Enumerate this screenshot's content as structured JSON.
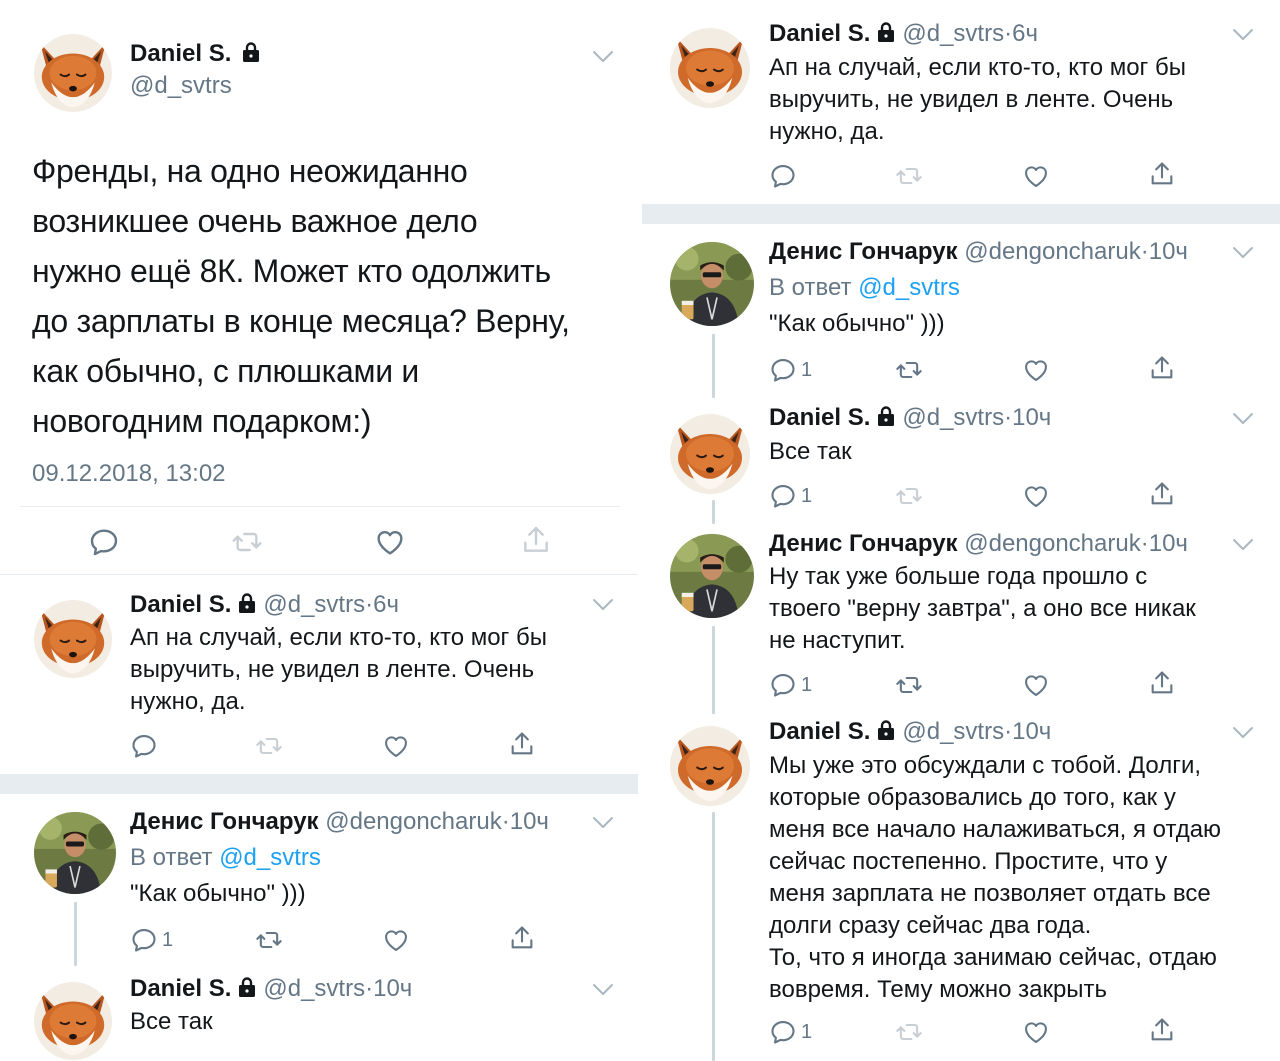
{
  "main_tweet": {
    "name": "Daniel S.",
    "handle": "@d_svtrs",
    "text": "Френды, на одно неожиданно\nвозникшее очень важное дело\nнужно ещё 8К. Может кто одолжить\nдо зарплаты в конце месяца? Верну,\nкак обычно, с плюшками и\nновогодним подарком:)",
    "timestamp": "09.12.2018, 13:02"
  },
  "left_tweets": [
    {
      "name": "Daniel S.",
      "handle": "@d_svtrs",
      "dot": "·",
      "time": "6ч",
      "text": "Ап на случай, если кто-то, кто мог бы\nвыручить, не увидел в ленте. Очень\nнужно, да."
    },
    {
      "name": "Денис Гончарук",
      "handle": "@dengoncharuk",
      "dot": "·",
      "time": "10ч",
      "reply_prefix": "В ответ",
      "reply_mention": "@d_svtrs",
      "text": "\"Как обычно\" )))",
      "reply_count": "1"
    },
    {
      "name": "Daniel S.",
      "handle": "@d_svtrs",
      "dot": "·",
      "time": "10ч",
      "text": "Все так"
    }
  ],
  "right_tweets": [
    {
      "name": "Daniel S.",
      "handle": "@d_svtrs",
      "dot": "·",
      "time": "6ч",
      "text": "Ап на случай, если кто-то, кто мог бы\nвыручить, не увидел в ленте. Очень\nнужно, да."
    },
    {
      "name": "Денис Гончарук",
      "handle": "@dengoncharuk",
      "dot": "·",
      "time": "10ч",
      "reply_prefix": "В ответ",
      "reply_mention": "@d_svtrs",
      "text": "\"Как обычно\" )))",
      "reply_count": "1"
    },
    {
      "name": "Daniel S.",
      "handle": "@d_svtrs",
      "dot": "·",
      "time": "10ч",
      "text": "Все так",
      "reply_count": "1"
    },
    {
      "name": "Денис Гончарук",
      "handle": "@dengoncharuk",
      "dot": "·",
      "time": "10ч",
      "text": "Ну так уже больше года прошло с\nтвоего \"верну завтра\", а оно все никак\nне наступит.",
      "reply_count": "1"
    },
    {
      "name": "Daniel S.",
      "handle": "@d_svtrs",
      "dot": "·",
      "time": "10ч",
      "text": "Мы уже это обсуждали с тобой. Долги,\nкоторые образовались до того, как у\nменя все начало налаживаться, я отдаю\nсейчас постепенно. Простите, что у\nменя зарплата не позволяет отдать все\nдолги сразу сейчас два года.\nТо, что я иногда занимаю сейчас, отдаю\nвовремя. Тему можно закрыть",
      "reply_count": "1"
    }
  ],
  "icons": {
    "reply": "reply-icon",
    "retweet": "retweet-icon",
    "like": "heart-icon",
    "share": "share-icon",
    "lock": "lock-icon",
    "chevron": "chevron-down-icon",
    "fox_avatar": "fox-avatar",
    "person_avatar": "person-avatar"
  },
  "colors": {
    "text": "#14171a",
    "secondary": "#657786",
    "link": "#1da1f2",
    "divider": "#e6ecf0",
    "thread_line": "#ccd6dd"
  }
}
